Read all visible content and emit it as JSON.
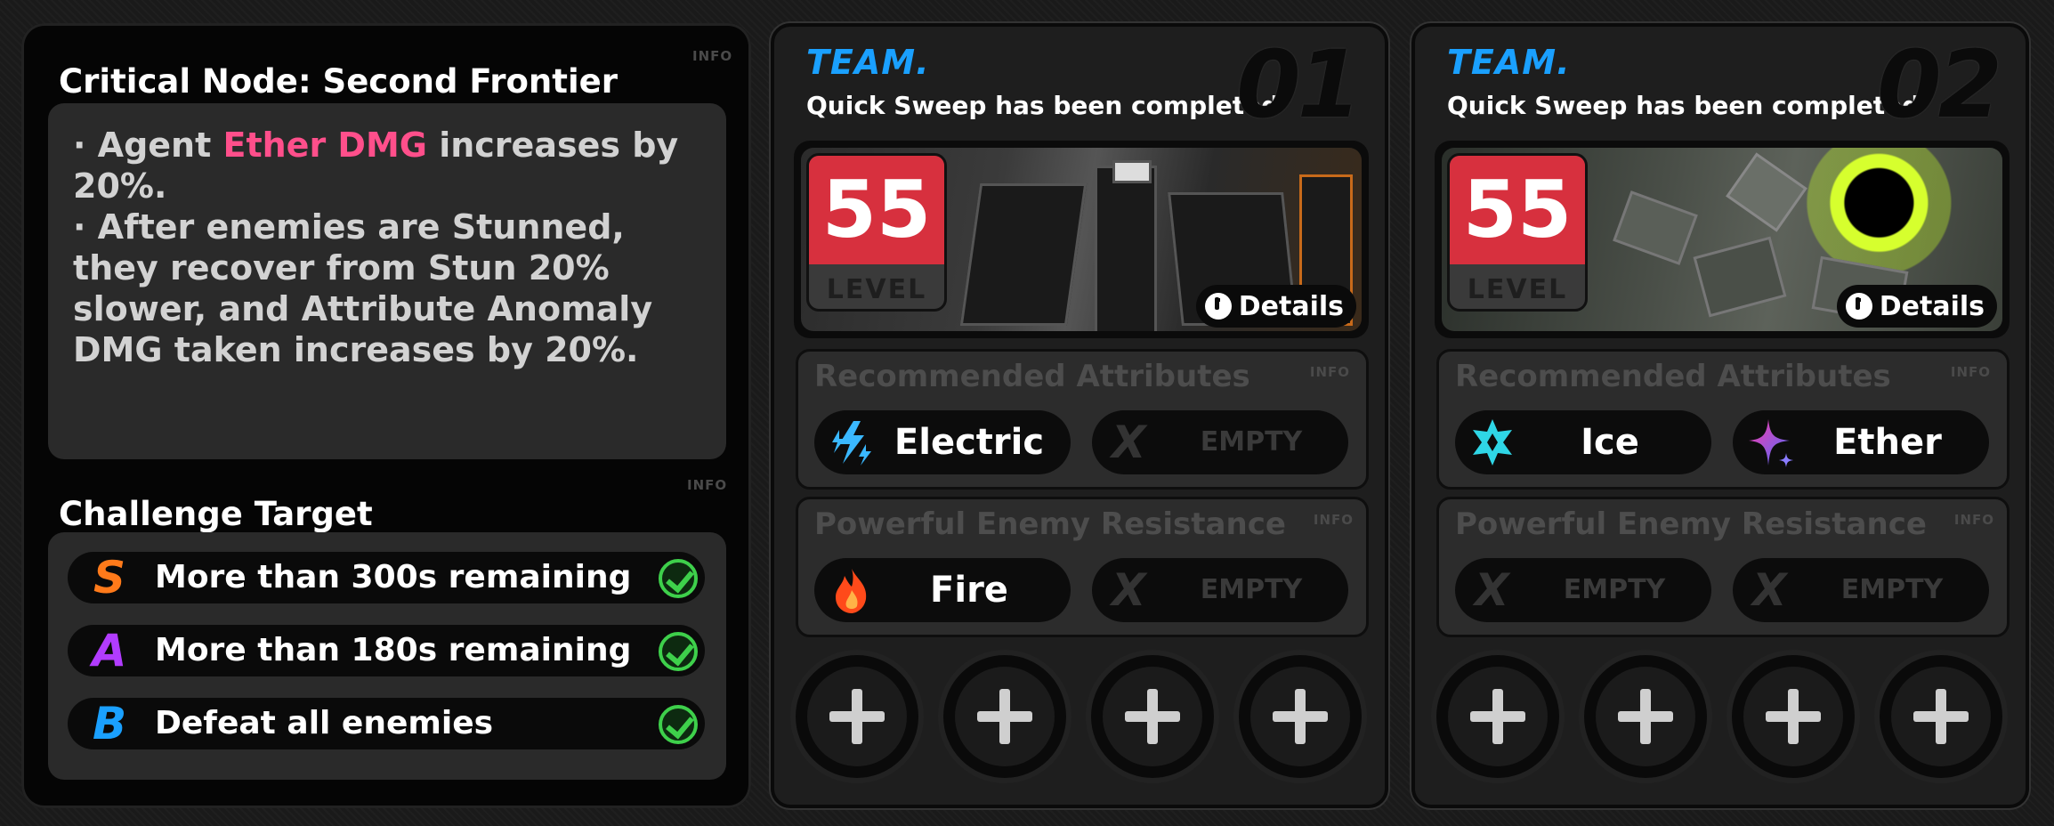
{
  "node": {
    "title": "Critical Node: Second Frontier",
    "info": "INFO",
    "desc_line1_pre": "· Agent ",
    "desc_line1_hl": "Ether DMG",
    "desc_line1_post": " increases by 20%.",
    "desc_line2": "· After enemies are Stunned, they recover from Stun 20% slower, and Attribute Anomaly DMG taken increases by 20%."
  },
  "challenge": {
    "title": "Challenge Target",
    "info": "INFO",
    "items": [
      {
        "rank": "S",
        "text": "More than 300s remaining",
        "color": "#ff7a1a"
      },
      {
        "rank": "A",
        "text": "More than 180s remaining",
        "color": "#b23cff"
      },
      {
        "rank": "B",
        "text": "Defeat all enemies",
        "color": "#1aa0ff"
      }
    ]
  },
  "teams": [
    {
      "label": "TEAM.",
      "number": "01",
      "status": "Quick Sweep has been completed",
      "level": "55",
      "level_text": "LEVEL",
      "details": "Details",
      "rec_title": "Recommended Attributes",
      "rec_info": "INFO",
      "rec": [
        {
          "label": "Electric",
          "icon": "electric-icon"
        },
        {
          "label": "EMPTY",
          "icon": "empty-x-icon"
        }
      ],
      "res_title": "Powerful Enemy Resistance",
      "res_info": "INFO",
      "res": [
        {
          "label": "Fire",
          "icon": "fire-icon"
        },
        {
          "label": "EMPTY",
          "icon": "empty-x-icon"
        }
      ]
    },
    {
      "label": "TEAM.",
      "number": "02",
      "status": "Quick Sweep has been completed",
      "level": "55",
      "level_text": "LEVEL",
      "details": "Details",
      "rec_title": "Recommended Attributes",
      "rec_info": "INFO",
      "rec": [
        {
          "label": "Ice",
          "icon": "ice-icon"
        },
        {
          "label": "Ether",
          "icon": "ether-icon"
        }
      ],
      "res_title": "Powerful Enemy Resistance",
      "res_info": "INFO",
      "res": [
        {
          "label": "EMPTY",
          "icon": "empty-x-icon"
        },
        {
          "label": "EMPTY",
          "icon": "empty-x-icon"
        }
      ]
    }
  ]
}
